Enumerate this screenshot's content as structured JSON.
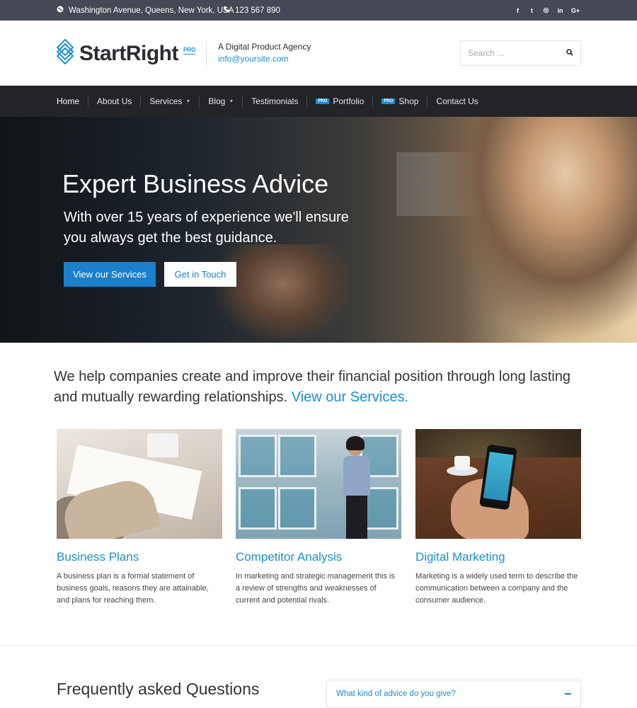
{
  "topbar": {
    "address": "Washington Avenue, Queens, New York, USA",
    "phone": "123 567 890",
    "socials": [
      "facebook-icon",
      "twitter-icon",
      "instagram-icon",
      "linkedin-icon",
      "google-plus-icon"
    ],
    "social_glyphs": [
      "f",
      "t",
      "◎",
      "in",
      "G+"
    ]
  },
  "header": {
    "logo_text": "StartRight",
    "logo_pro": "PRO",
    "tagline": "A Digital Product Agency",
    "email": "info@yoursite.com",
    "search_placeholder": "Search ..."
  },
  "nav": {
    "items": [
      {
        "label": "Home"
      },
      {
        "label": "About Us"
      },
      {
        "label": "Services"
      },
      {
        "label": "Blog"
      },
      {
        "label": "Testimonials"
      },
      {
        "label": "Portfolio",
        "badge": "PRO"
      },
      {
        "label": "Shop",
        "badge": "PRO"
      },
      {
        "label": "Contact Us"
      }
    ]
  },
  "hero": {
    "title": "Expert Business Advice",
    "subtitle": "With over 15 years of experience we'll ensure you always get the best guidance.",
    "primary_button": "View our Services",
    "secondary_button": "Get in Touch"
  },
  "intro": {
    "text": "We help companies create and improve their financial position through long lasting and mutually rewarding relationships.",
    "link_text": "View our Services."
  },
  "cards": [
    {
      "title": "Business Plans",
      "text": "A business plan is a formal statement of business goals, reasons they are attainable, and plans for reaching them."
    },
    {
      "title": "Competitor Analysis",
      "text": "In marketing and strategic management this is a review of strengths and weaknesses of current and potential rivals."
    },
    {
      "title": "Digital Marketing",
      "text": "Marketing is a widely used term to describe the communication between a company and the consumer audience."
    }
  ],
  "faq": {
    "title": "Frequently asked Questions",
    "question": "What kind of advice do you give?"
  },
  "colors": {
    "accent": "#1a8fd4",
    "topbar": "#454855",
    "nav": "#222428"
  }
}
